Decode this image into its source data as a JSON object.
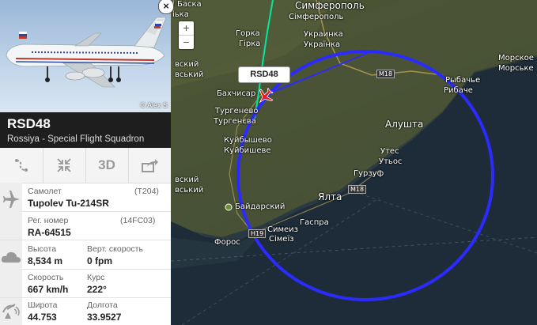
{
  "map": {
    "labels": [
      {
        "text": "Симферополь",
        "id": "simferopol-ru"
      },
      {
        "text": "Сімферополь",
        "id": "simferopol-ua"
      },
      {
        "text": "Горка",
        "id": "gorka-ru"
      },
      {
        "text": "Гірка",
        "id": "girka-ua"
      },
      {
        "text": "Украинка",
        "id": "ukrainka-ru"
      },
      {
        "text": "Українка",
        "id": "ukrainka-ua"
      },
      {
        "text": "Морское",
        "id": "morskoe-ru"
      },
      {
        "text": "Морське",
        "id": "morske-ua"
      },
      {
        "text": "Рыбачье",
        "id": "rybachye-ru"
      },
      {
        "text": "Рибаче",
        "id": "rybache-ua"
      },
      {
        "text": "Бахчисар",
        "id": "bakhchisar"
      },
      {
        "text": "Тургенево",
        "id": "turgenevo-ru"
      },
      {
        "text": "Тургенєва",
        "id": "turgeneva-ua"
      },
      {
        "text": "Куйбышево",
        "id": "kuibyshevo-ru"
      },
      {
        "text": "Куйбишеве",
        "id": "kuibysheve-ua"
      },
      {
        "text": "Алушта",
        "id": "alushta"
      },
      {
        "text": "Утес",
        "id": "utes-ru"
      },
      {
        "text": "Утьос",
        "id": "utyos-ua"
      },
      {
        "text": "Гурзуф",
        "id": "gurzuf"
      },
      {
        "text": "Ялта",
        "id": "yalta"
      },
      {
        "text": "Байдарский",
        "id": "baidarsky"
      },
      {
        "text": "Симеиз",
        "id": "simeiz-ru"
      },
      {
        "text": "Сімеїз",
        "id": "simeiz-ua"
      },
      {
        "text": "Гаспра",
        "id": "gaspra"
      },
      {
        "text": "Форос",
        "id": "foros"
      },
      {
        "text": "вский",
        "id": "frag1"
      },
      {
        "text": "вський",
        "id": "frag2"
      },
      {
        "text": "вский",
        "id": "frag3"
      },
      {
        "text": "вський",
        "id": "frag4"
      },
      {
        "text": "і Баска",
        "id": "frag5"
      },
      {
        "text": "іька",
        "id": "frag6"
      }
    ],
    "roads": {
      "m18a": "M18",
      "m18b": "M18",
      "h19": "H19"
    },
    "zoom_in": "+",
    "zoom_out": "−",
    "callsign_tag": "RSD48",
    "track_color": "#00e8a0",
    "circle_color": "#2b2bff"
  },
  "flight": {
    "photo_credit": "© Alex S",
    "close": "×",
    "callsign": "RSD48",
    "airline": "Rossiya - Special Flight Squadron",
    "tools": {
      "route": "route-icon",
      "fit": "fit-icon",
      "view3d": "3D",
      "share": "share-icon"
    },
    "aircraft_label": "Самолет",
    "aircraft_code": "(T204)",
    "aircraft_type": "Tupolev Tu-214SR",
    "reg_label": "Рег. номер",
    "reg_code": "(14FC03)",
    "reg_value": "RA-64515",
    "altitude_label": "Высота",
    "altitude_value": "8,534 m",
    "vspeed_label": "Верт. скорость",
    "vspeed_value": "0 fpm",
    "speed_label": "Скорость",
    "speed_value": "667 km/h",
    "heading_label": "Курс",
    "heading_value": "222°",
    "lat_label": "Широта",
    "lat_value": "44.753",
    "lon_label": "Долгота",
    "lon_value": "33.9527"
  }
}
